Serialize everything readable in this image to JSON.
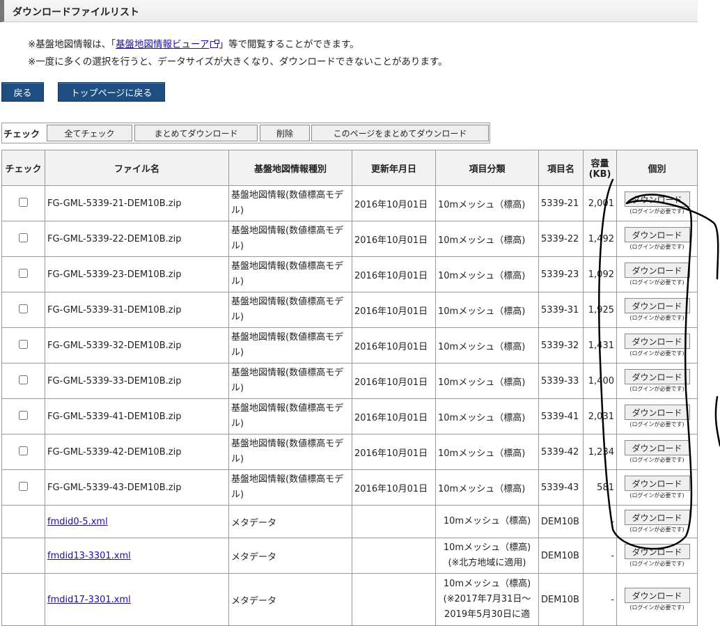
{
  "page": {
    "title": "ダウンロードファイルリスト",
    "note1_pre": "※基盤地図情報は、「",
    "note1_link": "基盤地図情報ビューア",
    "note1_post": "」等で閲覧することができます。",
    "note2": "※一度に多くの選択を行うと、データサイズが大きくなり、ダウンロードできないことがあります。"
  },
  "nav": {
    "back": "戻る",
    "top": "トップページに戻る"
  },
  "toolbar": {
    "label": "チェック",
    "check_all": "全てチェック",
    "bulk_download": "まとめてダウンロード",
    "delete": "削除",
    "page_download": "このページをまとめてダウンロード"
  },
  "table": {
    "headers": [
      "チェック",
      "ファイル名",
      "基盤地図情報種別",
      "更新年月日",
      "項目分類",
      "項目名",
      "容量(KB)",
      "個別"
    ],
    "download_label": "ダウンロード",
    "login_note": "(ログインが必要です)",
    "rows": [
      {
        "file": "FG-GML-5339-21-DEM10B.zip",
        "type": "基盤地図情報(数値標高モデル)",
        "date": "2016年10月01日",
        "category": "10mメッシュ（標高)",
        "item": "5339-21",
        "size": "2,001"
      },
      {
        "file": "FG-GML-5339-22-DEM10B.zip",
        "type": "基盤地図情報(数値標高モデル)",
        "date": "2016年10月01日",
        "category": "10mメッシュ（標高)",
        "item": "5339-22",
        "size": "1,492"
      },
      {
        "file": "FG-GML-5339-23-DEM10B.zip",
        "type": "基盤地図情報(数値標高モデル)",
        "date": "2016年10月01日",
        "category": "10mメッシュ（標高)",
        "item": "5339-23",
        "size": "1,092"
      },
      {
        "file": "FG-GML-5339-31-DEM10B.zip",
        "type": "基盤地図情報(数値標高モデル)",
        "date": "2016年10月01日",
        "category": "10mメッシュ（標高)",
        "item": "5339-31",
        "size": "1,925"
      },
      {
        "file": "FG-GML-5339-32-DEM10B.zip",
        "type": "基盤地図情報(数値標高モデル)",
        "date": "2016年10月01日",
        "category": "10mメッシュ（標高)",
        "item": "5339-32",
        "size": "1,431"
      },
      {
        "file": "FG-GML-5339-33-DEM10B.zip",
        "type": "基盤地図情報(数値標高モデル)",
        "date": "2016年10月01日",
        "category": "10mメッシュ（標高)",
        "item": "5339-33",
        "size": "1,400"
      },
      {
        "file": "FG-GML-5339-41-DEM10B.zip",
        "type": "基盤地図情報(数値標高モデル)",
        "date": "2016年10月01日",
        "category": "10mメッシュ（標高)",
        "item": "5339-41",
        "size": "2,031"
      },
      {
        "file": "FG-GML-5339-42-DEM10B.zip",
        "type": "基盤地図情報(数値標高モデル)",
        "date": "2016年10月01日",
        "category": "10mメッシュ（標高)",
        "item": "5339-42",
        "size": "1,234"
      },
      {
        "file": "FG-GML-5339-43-DEM10B.zip",
        "type": "基盤地図情報(数値標高モデル)",
        "date": "2016年10月01日",
        "category": "10mメッシュ（標高)",
        "item": "5339-43",
        "size": "581"
      }
    ],
    "meta_rows": [
      {
        "file": "fmdid0-5.xml",
        "type": "メタデータ",
        "category": "10mメッシュ（標高)",
        "item": "DEM10B",
        "size": "-"
      },
      {
        "file": "fmdid13-3301.xml",
        "type": "メタデータ",
        "category": "10mメッシュ（標高)\n(※北方地域に適用)",
        "item": "DEM10B",
        "size": "-"
      },
      {
        "file": "fmdid17-3301.xml",
        "type": "メタデータ",
        "category": "10mメッシュ（標高)\n(※2017年7月31日～\n2019年5月30日に適",
        "item": "DEM10B",
        "size": "-"
      }
    ]
  }
}
